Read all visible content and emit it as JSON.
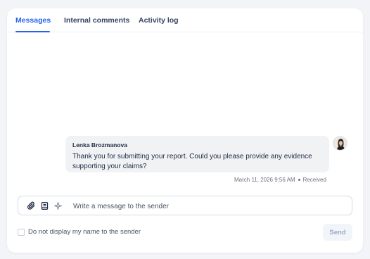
{
  "tabs": [
    {
      "label": "Messages",
      "active": true
    },
    {
      "label": "Internal comments",
      "active": false
    },
    {
      "label": "Activity log",
      "active": false
    }
  ],
  "message": {
    "sender": "Lenka Brozmanova",
    "text": "Thank you for submitting your report. Could you please provide any evidence supporting your claims?",
    "timestamp": "March 11, 2026 9:56 AM",
    "status": "Received"
  },
  "composer": {
    "placeholder": "Write a message to the sender",
    "icons": [
      "paperclip-icon",
      "template-icon",
      "sparkle-icon"
    ]
  },
  "options": {
    "hide_name_label": "Do not display my name to the sender",
    "hide_name_checked": false
  },
  "send_label": "Send",
  "colors": {
    "accent": "#2563eb",
    "send_disabled_text": "#9aa9c4",
    "bubble_bg": "#f1f2f4"
  }
}
